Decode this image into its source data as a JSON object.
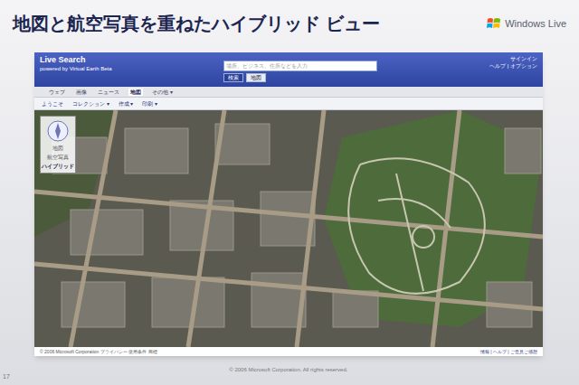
{
  "slide": {
    "title": "地図と航空写真を重ねたハイブリッド ビュー",
    "number": "17",
    "copyright": "© 2006 Microsoft Corporation. All rights reserved."
  },
  "logo": {
    "text": "Windows Live"
  },
  "app": {
    "brand": "Live Search",
    "tagline": "powered by Virtual Earth Beta",
    "search_placeholder": "場所、ビジネス、住所などを入力",
    "search_buttons": [
      {
        "label": "検索",
        "selected": true
      },
      {
        "label": "地図",
        "selected": false
      }
    ],
    "header_links": [
      "サインイン",
      "ヘルプ | オプション"
    ],
    "tabs": [
      {
        "label": "ウェブ",
        "selected": false
      },
      {
        "label": "画像",
        "selected": false
      },
      {
        "label": "ニュース",
        "selected": false
      },
      {
        "label": "地図",
        "selected": true
      },
      {
        "label": "その他 ▾",
        "selected": false
      }
    ],
    "menu": [
      "ようこそ",
      "コレクション ▾",
      "作成 ▾",
      "印刷 ▾"
    ],
    "view_modes": [
      {
        "label": "地図",
        "selected": false
      },
      {
        "label": "航空写真",
        "selected": false
      },
      {
        "label": "ハイブリッド",
        "selected": true
      }
    ],
    "footer_left": "© 2006 Microsoft Corporation  プライバシー  使用条件  商標",
    "footer_right": "情報 | ヘルプ | ご意見ご感想"
  }
}
